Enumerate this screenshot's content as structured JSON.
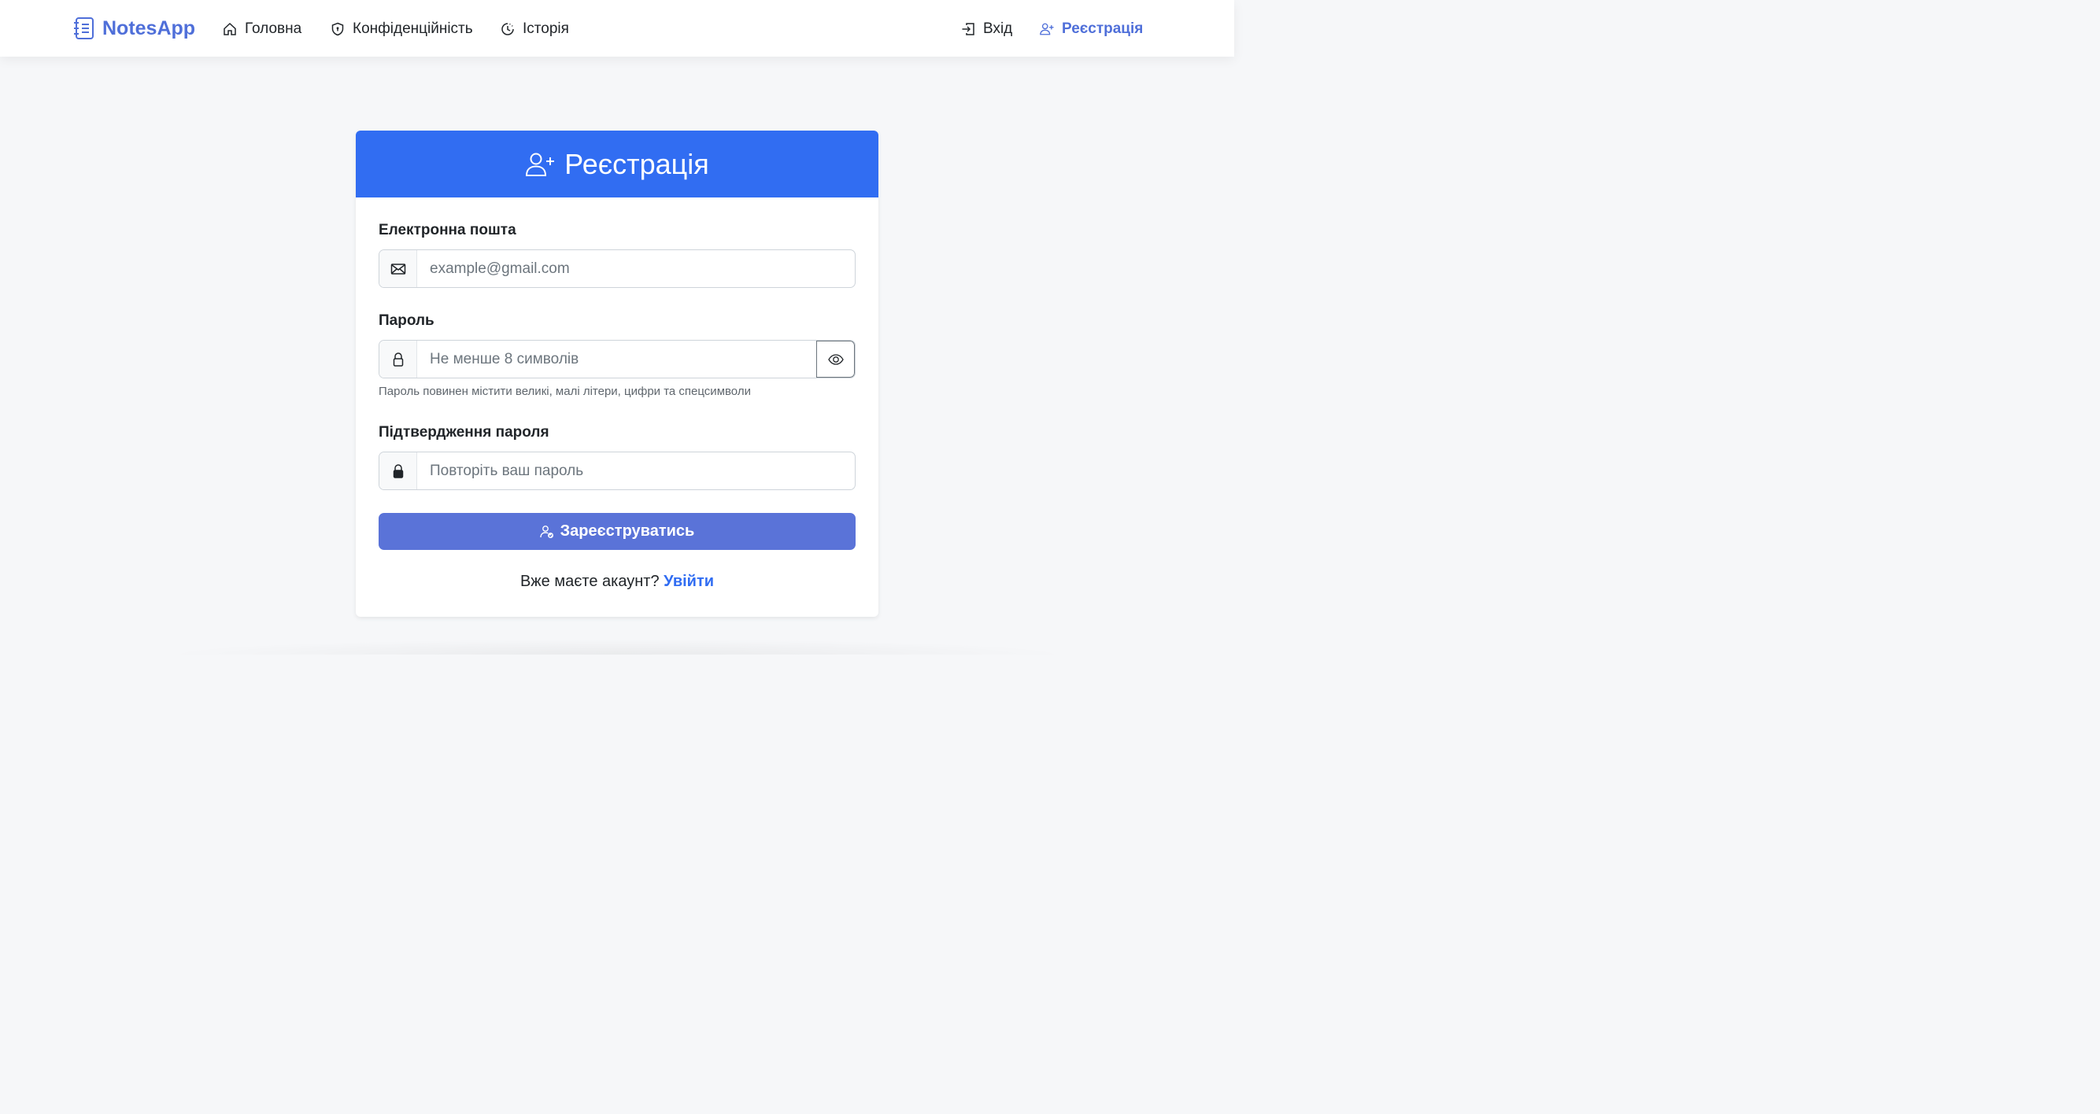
{
  "nav": {
    "brand": "NotesApp",
    "home": "Головна",
    "privacy": "Конфіденційність",
    "history": "Історія",
    "login": "Вхід",
    "register": "Реєстрація"
  },
  "colors": {
    "brand": "#4f6fd9",
    "header": "#316df2",
    "submit": "#5a73d8",
    "link": "#316df2"
  },
  "form": {
    "title": "Реєстрація",
    "email_label": "Електронна пошта",
    "email_placeholder": "example@gmail.com",
    "password_label": "Пароль",
    "password_placeholder": "Не менше 8 символів",
    "password_hint": "Пароль повинен містити великі, малі літери, цифри та спецсимволи",
    "confirm_label": "Підтвердження пароля",
    "confirm_placeholder": "Повторіть ваш пароль",
    "submit_label": "Зареєструватись",
    "have_account": "Вже маєте акаунт?",
    "login_link": "Увійти"
  }
}
